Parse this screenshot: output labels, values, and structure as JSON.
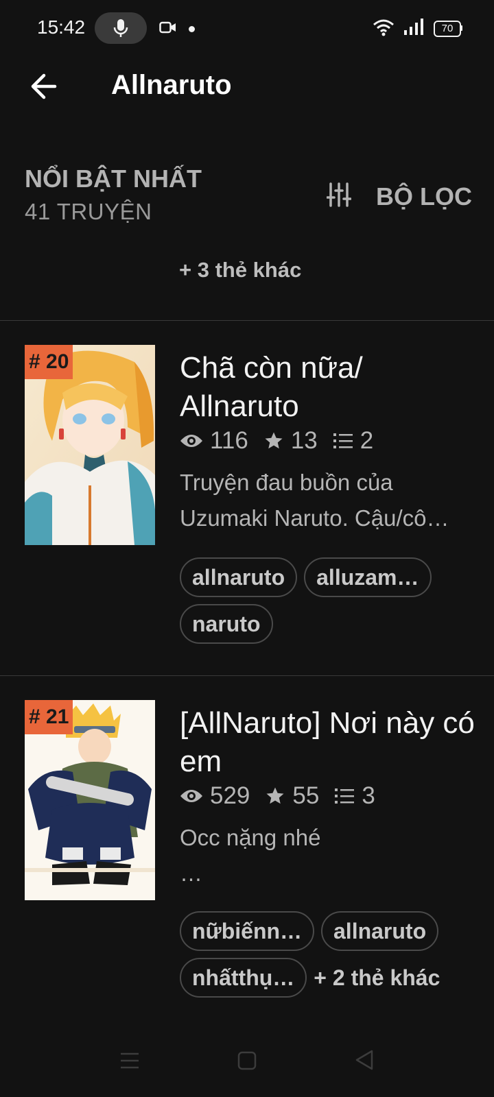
{
  "status_bar": {
    "time": "15:42",
    "battery": "70",
    "icons": [
      "microphone-icon",
      "video-camera-icon",
      "wifi-icon",
      "signal-icon",
      "battery-icon"
    ]
  },
  "app_bar": {
    "title": "Allnaruto",
    "back_icon": "arrow-left-icon"
  },
  "section": {
    "title": "NỔI BẬT NHẤT",
    "count": "41 TRUYỆN",
    "filter_label": "BỘ LỌC",
    "filter_icon": "sliders-icon",
    "more_tags": "+ 3 thẻ khác"
  },
  "stories": [
    {
      "rank": "# 20",
      "title": "Chã còn nữa/ Allnaruto",
      "views": "116",
      "votes": "13",
      "parts": "2",
      "description": "Truyện đau buồn của\nUzumaki Naruto. Cậu/cô…",
      "tags": [
        "allnaruto",
        "alluzam…",
        "naruto"
      ],
      "more_tags": ""
    },
    {
      "rank": "# 21",
      "title": "[AllNaruto] Nơi này có em",
      "views": "529",
      "votes": "55",
      "parts": "3",
      "description": "Occ nặng nhé\n…",
      "tags": [
        "nữbiếnn…",
        "allnaruto",
        "nhấtthụ…"
      ],
      "more_tags": "+ 2 thẻ khác"
    }
  ],
  "colors": {
    "background": "#121212",
    "rank_badge": "#e8663a"
  }
}
